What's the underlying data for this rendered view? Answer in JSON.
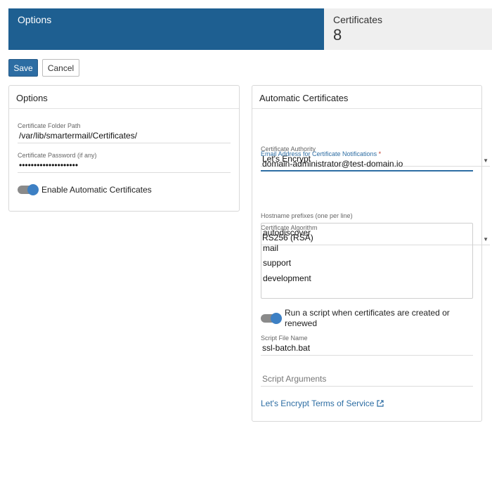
{
  "tabs": {
    "options_label": "Options",
    "certificates_label": "Certificates",
    "certificates_count": "8"
  },
  "toolbar": {
    "save_label": "Save",
    "cancel_label": "Cancel"
  },
  "options_card": {
    "title": "Options",
    "folder_path_label": "Certificate Folder Path",
    "folder_path_value": "/var/lib/smartermail/Certificates/",
    "password_label": "Certificate Password (if any)",
    "password_value": "••••••••••••••••••••",
    "auto_certs_label": "Enable Automatic Certificates"
  },
  "auto_card": {
    "title": "Automatic Certificates",
    "authority_label": "Certificate Authority",
    "authority_value": "Let's Encrypt",
    "email_label": "Email Address for Certificate Notifications",
    "email_required": "*",
    "email_value": "domain-administrator@test-domain.io",
    "algorithm_label": "Certificate Algorithm",
    "algorithm_value": "RS256 (RSA)",
    "hostname_label": "Hostname prefixes (one per line)",
    "hostnames": [
      "autodiscover",
      "mail",
      "support",
      "development"
    ],
    "script_toggle_label": "Run a script when certificates are created or renewed",
    "script_file_label": "Script File Name",
    "script_file_value": "ssl-batch.bat",
    "script_args_placeholder": "Script Arguments",
    "terms_link": "Let's Encrypt Terms of Service"
  },
  "colors": {
    "accent": "#1e5f91",
    "button": "#2d6da3",
    "toggle_knob": "#3d80c4"
  }
}
